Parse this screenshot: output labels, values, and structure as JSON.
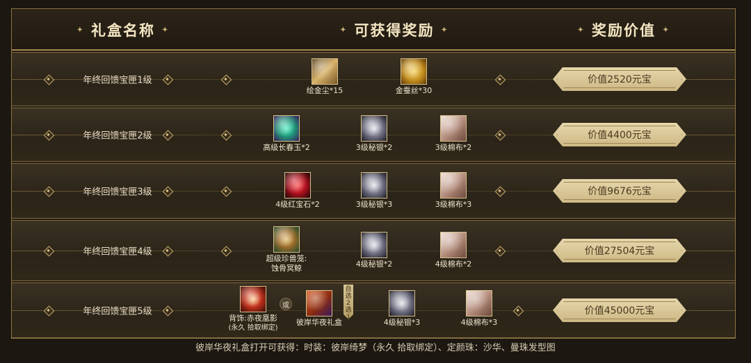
{
  "headers": {
    "name": "礼盒名称",
    "rewards": "可获得奖励",
    "value": "奖励价值"
  },
  "rows": [
    {
      "name": "年终回馈宝匣1级",
      "value": "价值2520元宝",
      "items": [
        {
          "label": "绘金尘*15",
          "icon": "gold-dust-icon"
        },
        {
          "label": "金蚕丝*30",
          "icon": "gold-silk-icon"
        }
      ]
    },
    {
      "name": "年终回馈宝匣2级",
      "value": "价值4400元宝",
      "items": [
        {
          "label": "高级长春玉*2",
          "icon": "jade-icon"
        },
        {
          "label": "3级秘银*2",
          "icon": "mithril-icon"
        },
        {
          "label": "3级棉布*2",
          "icon": "cotton-cloth-icon"
        }
      ]
    },
    {
      "name": "年终回馈宝匣3级",
      "value": "价值9676元宝",
      "items": [
        {
          "label": "4级红宝石*2",
          "icon": "ruby-icon"
        },
        {
          "label": "3级秘银*3",
          "icon": "mithril-icon"
        },
        {
          "label": "3级棉布*3",
          "icon": "cotton-cloth-icon"
        }
      ]
    },
    {
      "name": "年终回馈宝匣4级",
      "value": "价值27504元宝",
      "items": [
        {
          "label": "超级珍兽笼:",
          "label2": "蚀骨冥鲸",
          "icon": "pet-cage-icon"
        },
        {
          "label": "4级秘银*2",
          "icon": "mithril-icon"
        },
        {
          "label": "4级棉布*2",
          "icon": "cotton-cloth-icon"
        }
      ]
    },
    {
      "name": "年终回馈宝匣5级",
      "value": "价值45000元宝",
      "or": "或",
      "choose": "自选2选1",
      "items": [
        {
          "label": "背饰:赤夜凰影",
          "label2": "(永久 拾取绑定)",
          "icon": "phoenix-back-icon"
        },
        {
          "label": "彼岸华夜礼盒",
          "icon": "gift-box-icon"
        },
        {
          "label": "4级秘银*3",
          "icon": "mithril-icon"
        },
        {
          "label": "4级棉布*3",
          "icon": "cotton-cloth-icon"
        }
      ]
    }
  ],
  "footer": "彼岸华夜礼盒打开可获得：时装：彼岸绮梦（永久 拾取绑定）、定颜珠：沙华、曼珠发型图",
  "colors": {
    "frame": "#8a7444",
    "plate": "#e6d6ab",
    "background": "#1c1710"
  }
}
